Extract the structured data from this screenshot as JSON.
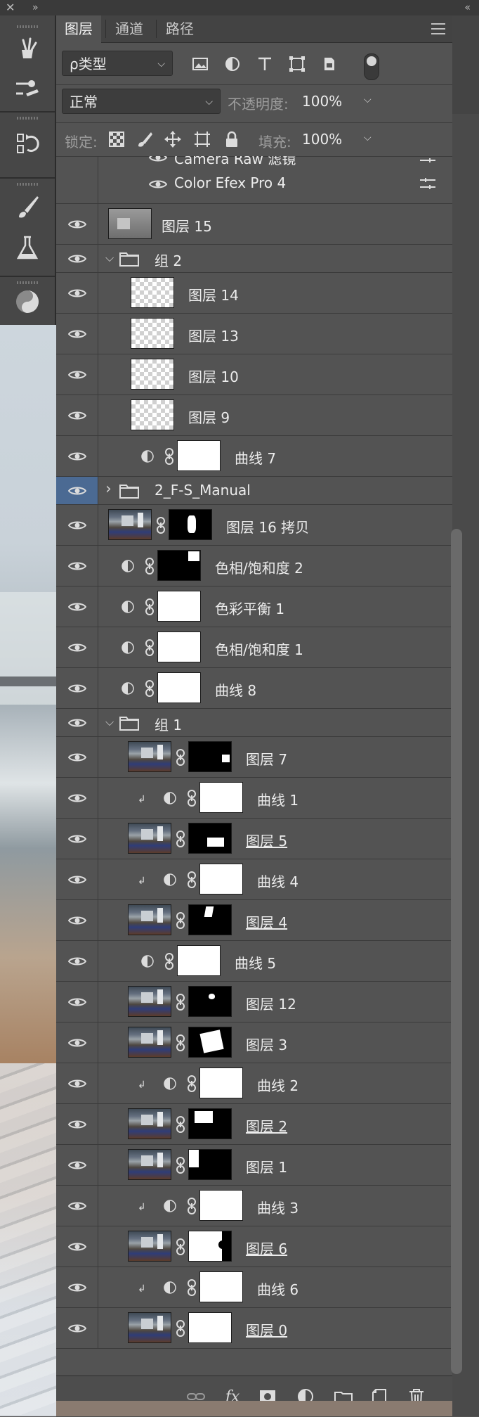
{
  "window": {
    "close_glyph": "✕",
    "collapse_left_glyph": "»",
    "collapse_right_glyph": "«"
  },
  "tabs": [
    {
      "label": "图层",
      "active": true
    },
    {
      "label": "通道",
      "active": false
    },
    {
      "label": "路径",
      "active": false
    }
  ],
  "filter": {
    "kind_label": "ρ类型"
  },
  "blend": {
    "mode": "正常",
    "opacity_label": "不透明度:",
    "opacity_value": "100%"
  },
  "lock": {
    "label": "锁定:",
    "fill_label": "填充:",
    "fill_value": "100%"
  },
  "smart_filters": [
    {
      "label": "Camera Raw 滤镜"
    },
    {
      "label": "Color Efex Pro 4"
    }
  ],
  "layers": [
    {
      "name": "图层 15",
      "kind": "smart",
      "indent": 0
    },
    {
      "name": "组 2",
      "kind": "group-open",
      "indent": 0
    },
    {
      "name": "图层 14",
      "kind": "transparent",
      "indent": 1
    },
    {
      "name": "图层 13",
      "kind": "transparent",
      "indent": 1
    },
    {
      "name": "图层 10",
      "kind": "transparent",
      "indent": 1
    },
    {
      "name": "图层 9",
      "kind": "transparent",
      "indent": 1
    },
    {
      "name": "曲线 7",
      "kind": "adjustment",
      "indent": 1
    },
    {
      "name": "2_F-S_Manual",
      "kind": "group-closed",
      "indent": 0,
      "selected": true
    },
    {
      "name": "图层 16 拷贝",
      "kind": "photo-mask",
      "indent": 0,
      "mask": "small-white"
    },
    {
      "name": "色相/饱和度 2",
      "kind": "adjustment-mask",
      "indent": 0,
      "mask": "black-corner"
    },
    {
      "name": "色彩平衡 1",
      "kind": "adjustment",
      "indent": 0
    },
    {
      "name": "色相/饱和度 1",
      "kind": "adjustment",
      "indent": 0
    },
    {
      "name": "曲线 8",
      "kind": "adjustment",
      "indent": 0
    },
    {
      "name": "组 1",
      "kind": "group-open",
      "indent": 0
    },
    {
      "name": "图层 7",
      "kind": "photo-mask",
      "indent": 1,
      "mask": "black-dot-right"
    },
    {
      "name": "曲线 1",
      "kind": "clip-adjustment",
      "indent": 1
    },
    {
      "name": "图层 5",
      "kind": "photo-mask",
      "indent": 1,
      "mask": "black-block",
      "underline": true
    },
    {
      "name": "曲线 4",
      "kind": "clip-adjustment",
      "indent": 1
    },
    {
      "name": "图层 4",
      "kind": "photo-mask",
      "indent": 1,
      "mask": "black-top-mark",
      "underline": true
    },
    {
      "name": "曲线 5",
      "kind": "adjustment",
      "indent": 1
    },
    {
      "name": "图层 12",
      "kind": "photo-mask",
      "indent": 1,
      "mask": "black-dot-mid"
    },
    {
      "name": "图层 3",
      "kind": "photo-mask",
      "indent": 1,
      "mask": "black-shape"
    },
    {
      "name": "曲线 2",
      "kind": "clip-adjustment",
      "indent": 1
    },
    {
      "name": "图层 2",
      "kind": "photo-mask",
      "indent": 1,
      "mask": "black-topleft",
      "underline": true
    },
    {
      "name": "图层 1",
      "kind": "photo-mask",
      "indent": 1,
      "mask": "black-leftbar"
    },
    {
      "name": "曲线 3",
      "kind": "clip-adjustment",
      "indent": 1
    },
    {
      "name": "图层 6",
      "kind": "photo-mask",
      "indent": 1,
      "mask": "white-right-black",
      "underline": true
    },
    {
      "name": "曲线 6",
      "kind": "clip-adjustment",
      "indent": 1
    },
    {
      "name": "图层 0",
      "kind": "photo-mask",
      "indent": 1,
      "mask": "white",
      "underline": true
    }
  ],
  "bottom_toolbar": {
    "fx_label": "fx"
  },
  "colors": {
    "panel_bg": "#535353",
    "selected": "#4b6a93",
    "tab_bar": "#434343"
  }
}
